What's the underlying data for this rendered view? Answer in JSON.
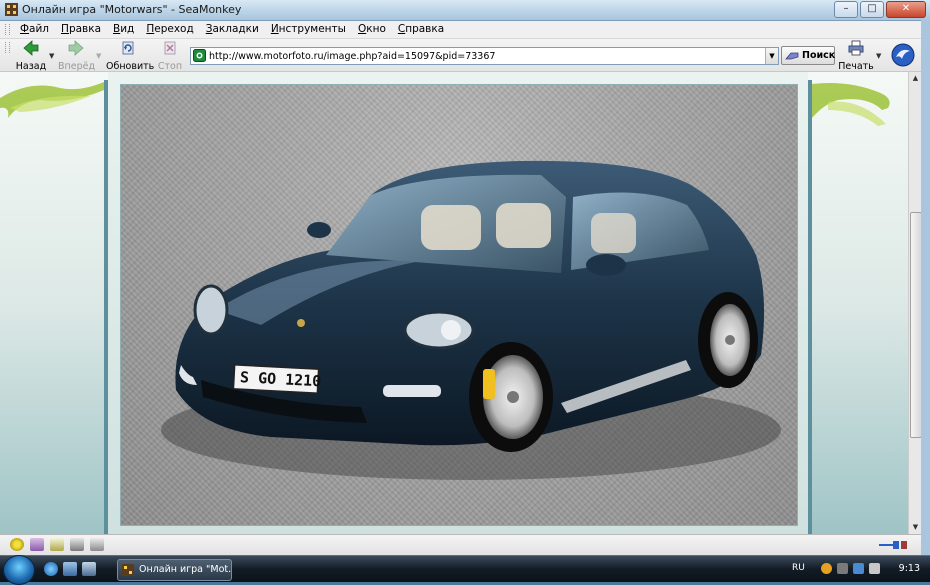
{
  "window": {
    "title": "Онлайн игра \"Motorwars\" - SeaMonkey",
    "buttons": [
      "–",
      "□",
      "✕"
    ]
  },
  "menu": {
    "items": [
      "Файл",
      "Правка",
      "Вид",
      "Переход",
      "Закладки",
      "Инструменты",
      "Окно",
      "Справка"
    ]
  },
  "toolbar": {
    "back_label": "Назад",
    "forward_label": "Вперёд",
    "reload_label": "Обновить",
    "stop_label": "Стоп",
    "search_label": "Поиск",
    "print_label": "Печать"
  },
  "address": {
    "url": "http://www.motorfoto.ru/image.php?aid=15097&pid=73367"
  },
  "photo": {
    "plate_text": "S GO 1210",
    "car_color": "#1d3448"
  },
  "colors": {
    "frame": "#5e8f9d",
    "titlebar": "#b9d2e6"
  },
  "taskbar": {
    "task_label": "Онлайн игра \"Mot...",
    "lang": "RU",
    "clock": "9:13"
  }
}
